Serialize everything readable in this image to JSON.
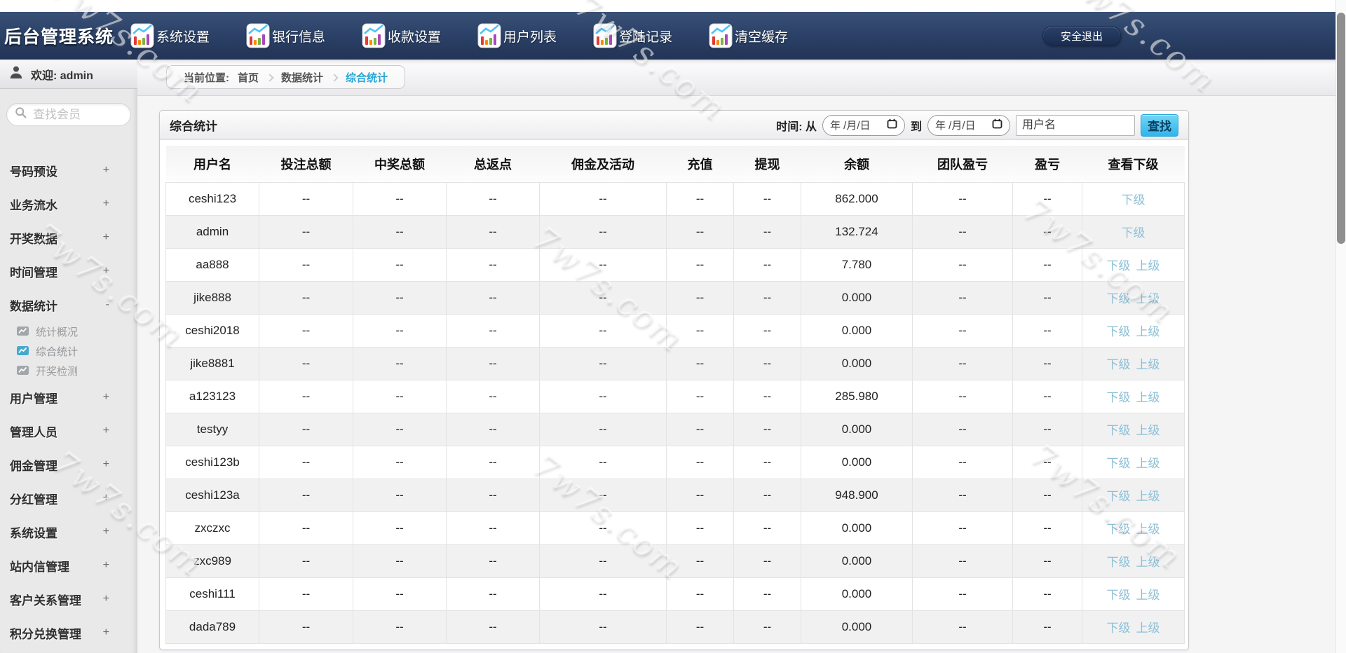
{
  "navbar": {
    "logo": "后台管理系统",
    "items": [
      {
        "label": "系统设置"
      },
      {
        "label": "银行信息"
      },
      {
        "label": "收款设置"
      },
      {
        "label": "用户列表"
      },
      {
        "label": "登陆记录"
      },
      {
        "label": "清空缓存"
      }
    ],
    "logout_label": "安全退出"
  },
  "sidebar": {
    "welcome": "欢迎: admin",
    "search_placeholder": "查找会员",
    "menu": [
      {
        "label": "号码预设",
        "toggle": "+"
      },
      {
        "label": "业务流水",
        "toggle": "+"
      },
      {
        "label": "开奖数据",
        "toggle": "+"
      },
      {
        "label": "时间管理",
        "toggle": "+"
      },
      {
        "label": "数据统计",
        "toggle": "-",
        "expanded": true,
        "children": [
          {
            "label": "统计概况",
            "active": false
          },
          {
            "label": "综合统计",
            "active": true
          },
          {
            "label": "开奖检测",
            "active": false
          }
        ]
      },
      {
        "label": "用户管理",
        "toggle": "+"
      },
      {
        "label": "管理人员",
        "toggle": "+"
      },
      {
        "label": "佣金管理",
        "toggle": "+"
      },
      {
        "label": "分红管理",
        "toggle": "+"
      },
      {
        "label": "系统设置",
        "toggle": "+"
      },
      {
        "label": "站内信管理",
        "toggle": "+"
      },
      {
        "label": "客户关系管理",
        "toggle": "+"
      },
      {
        "label": "积分兑换管理",
        "toggle": "+"
      }
    ]
  },
  "breadcrumb": {
    "prefix": "当前位置:",
    "items": [
      "首页",
      "数据统计",
      "综合统计"
    ]
  },
  "panel": {
    "title": "综合统计",
    "filter": {
      "time_label": "时间: 从",
      "to_label": "到",
      "date_placeholder": "年 /月/日",
      "username_placeholder": "用户名",
      "search_button": "查找"
    }
  },
  "table": {
    "columns": [
      "用户名",
      "投注总额",
      "中奖总额",
      "总返点",
      "佣金及活动",
      "充值",
      "提现",
      "余额",
      "团队盈亏",
      "盈亏",
      "查看下级"
    ],
    "rows": [
      {
        "cells": [
          "ceshi123",
          "--",
          "--",
          "--",
          "--",
          "--",
          "--",
          "862.000",
          "--",
          "--"
        ],
        "links": [
          "下级"
        ]
      },
      {
        "cells": [
          "admin",
          "--",
          "--",
          "--",
          "--",
          "--",
          "--",
          "132.724",
          "--",
          "--"
        ],
        "links": [
          "下级"
        ]
      },
      {
        "cells": [
          "aa888",
          "--",
          "--",
          "--",
          "--",
          "--",
          "--",
          "7.780",
          "--",
          "--"
        ],
        "links": [
          "下级",
          "上级"
        ]
      },
      {
        "cells": [
          "jike888",
          "--",
          "--",
          "--",
          "--",
          "--",
          "--",
          "0.000",
          "--",
          "--"
        ],
        "links": [
          "下级",
          "上级"
        ]
      },
      {
        "cells": [
          "ceshi2018",
          "--",
          "--",
          "--",
          "--",
          "--",
          "--",
          "0.000",
          "--",
          "--"
        ],
        "links": [
          "下级",
          "上级"
        ]
      },
      {
        "cells": [
          "jike8881",
          "--",
          "--",
          "--",
          "--",
          "--",
          "--",
          "0.000",
          "--",
          "--"
        ],
        "links": [
          "下级",
          "上级"
        ]
      },
      {
        "cells": [
          "a123123",
          "--",
          "--",
          "--",
          "--",
          "--",
          "--",
          "285.980",
          "--",
          "--"
        ],
        "links": [
          "下级",
          "上级"
        ]
      },
      {
        "cells": [
          "testyy",
          "--",
          "--",
          "--",
          "--",
          "--",
          "--",
          "0.000",
          "--",
          "--"
        ],
        "links": [
          "下级",
          "上级"
        ]
      },
      {
        "cells": [
          "ceshi123b",
          "--",
          "--",
          "--",
          "--",
          "--",
          "--",
          "0.000",
          "--",
          "--"
        ],
        "links": [
          "下级",
          "上级"
        ]
      },
      {
        "cells": [
          "ceshi123a",
          "--",
          "--",
          "--",
          "--",
          "--",
          "--",
          "948.900",
          "--",
          "--"
        ],
        "links": [
          "下级",
          "上级"
        ]
      },
      {
        "cells": [
          "zxczxc",
          "--",
          "--",
          "--",
          "--",
          "--",
          "--",
          "0.000",
          "--",
          "--"
        ],
        "links": [
          "下级",
          "上级"
        ]
      },
      {
        "cells": [
          "zxc989",
          "--",
          "--",
          "--",
          "--",
          "--",
          "--",
          "0.000",
          "--",
          "--"
        ],
        "links": [
          "下级",
          "上级"
        ]
      },
      {
        "cells": [
          "ceshi111",
          "--",
          "--",
          "--",
          "--",
          "--",
          "--",
          "0.000",
          "--",
          "--"
        ],
        "links": [
          "下级",
          "上级"
        ]
      },
      {
        "cells": [
          "dada789",
          "--",
          "--",
          "--",
          "--",
          "--",
          "--",
          "0.000",
          "--",
          "--"
        ],
        "links": [
          "下级",
          "上级"
        ]
      }
    ]
  },
  "watermark": {
    "text": "7w7s.com"
  },
  "colors": {
    "navy": "#2b4166",
    "accent": "#25a6d6",
    "link": "#8cc0d6",
    "button": "#3fc3ef"
  }
}
